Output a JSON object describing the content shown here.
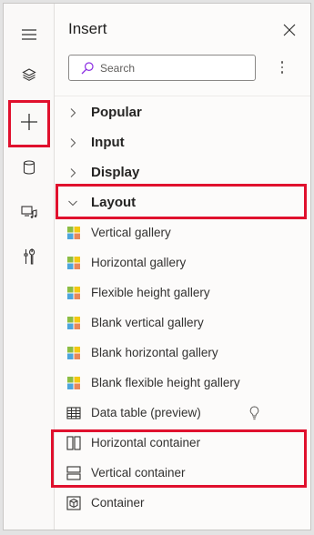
{
  "panel": {
    "title": "Insert",
    "search_placeholder": "Search"
  },
  "rail": {
    "items": [
      "hamburger-menu-icon",
      "layers-icon",
      "plus-icon",
      "database-icon",
      "media-icon",
      "tools-icon"
    ]
  },
  "categories": [
    {
      "label": "Popular",
      "expanded": false
    },
    {
      "label": "Input",
      "expanded": false
    },
    {
      "label": "Display",
      "expanded": false
    },
    {
      "label": "Layout",
      "expanded": true
    }
  ],
  "layout_items": [
    {
      "label": "Vertical gallery",
      "icon": "gallery-icon"
    },
    {
      "label": "Horizontal gallery",
      "icon": "gallery-icon"
    },
    {
      "label": "Flexible height gallery",
      "icon": "gallery-icon"
    },
    {
      "label": "Blank vertical gallery",
      "icon": "gallery-icon"
    },
    {
      "label": "Blank horizontal gallery",
      "icon": "gallery-icon"
    },
    {
      "label": "Blank flexible height gallery",
      "icon": "gallery-icon"
    },
    {
      "label": "Data table (preview)",
      "icon": "table-icon"
    },
    {
      "label": "Horizontal container",
      "icon": "horizontal-container-icon"
    },
    {
      "label": "Vertical container",
      "icon": "vertical-container-icon"
    },
    {
      "label": "Container",
      "icon": "container-icon"
    }
  ],
  "colors": {
    "highlight": "#e0102d",
    "gallery_green": "#8cbd43",
    "gallery_yellow": "#f2c811",
    "gallery_blue": "#4ea6dc",
    "gallery_orange": "#e8885a"
  }
}
